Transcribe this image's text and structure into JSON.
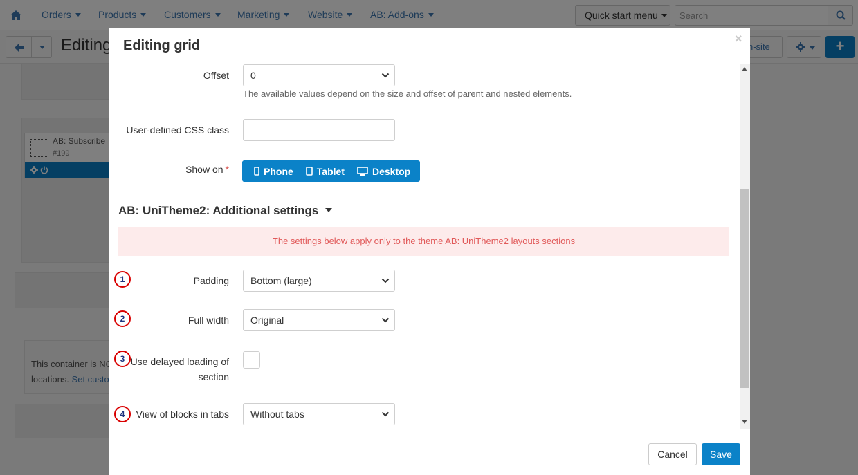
{
  "topnav": {
    "items": [
      {
        "label": "Orders"
      },
      {
        "label": "Products"
      },
      {
        "label": "Customers"
      },
      {
        "label": "Marketing"
      },
      {
        "label": "Website"
      },
      {
        "label": "AB: Add-ons"
      }
    ],
    "quick_start": "Quick start menu",
    "search_placeholder": "Search"
  },
  "page": {
    "title": "Editing",
    "onsite_label": "n-site"
  },
  "background": {
    "block_name": "AB: Subscribe",
    "block_id": "#199",
    "note_line1": "This container is NO",
    "note_line2_prefix": "locations.",
    "note_link": "Set custo"
  },
  "modal": {
    "title": "Editing grid",
    "close": "×",
    "offset": {
      "label": "Offset",
      "value": "0",
      "help": "The available values depend on the size and offset of parent and nested elements."
    },
    "css_class": {
      "label": "User-defined CSS class",
      "value": ""
    },
    "show_on": {
      "label": "Show on",
      "required_mark": "*",
      "devices": [
        {
          "label": "Phone",
          "icon": "phone-icon"
        },
        {
          "label": "Tablet",
          "icon": "tablet-icon"
        },
        {
          "label": "Desktop",
          "icon": "desktop-icon"
        }
      ]
    },
    "section_title": "AB: UniTheme2: Additional settings",
    "alert_text": "The settings below apply only to the theme AB: UniTheme2 layouts sections",
    "padding": {
      "badge": "1",
      "label": "Padding",
      "value": "Bottom (large)"
    },
    "full_width": {
      "badge": "2",
      "label": "Full width",
      "value": "Original"
    },
    "delayed": {
      "badge": "3",
      "label_line1": "Use delayed loading of",
      "label_line2": "section",
      "checked": false
    },
    "tabs_view": {
      "badge": "4",
      "label": "View of blocks in tabs",
      "value": "Without tabs"
    },
    "cancel_label": "Cancel",
    "save_label": "Save"
  },
  "colors": {
    "primary": "#0b82c8",
    "alert_bg": "#fdebeb",
    "alert_text": "#e15959",
    "badge_ring": "#d90000"
  }
}
